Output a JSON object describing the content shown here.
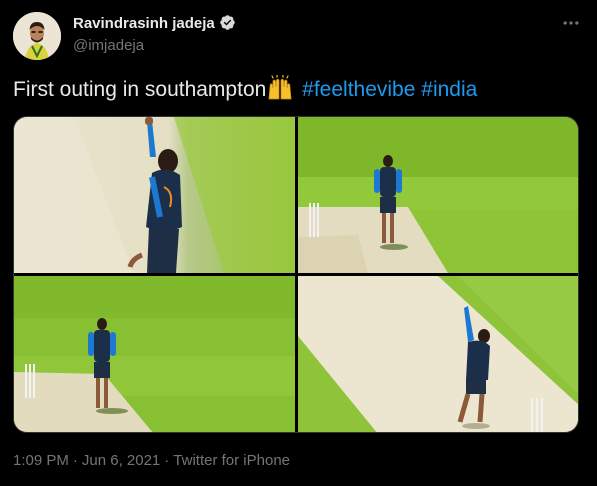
{
  "author": {
    "name": "Ravindrasinh jadeja",
    "handle": "@imjadeja",
    "verified": true
  },
  "tweet": {
    "text": "First outing in southampton",
    "emoji": "raising-hands",
    "hashtags": [
      "#feelthevibe",
      "#india"
    ]
  },
  "media": {
    "photos": [
      {
        "label": "photo-1"
      },
      {
        "label": "photo-2"
      },
      {
        "label": "photo-3"
      },
      {
        "label": "photo-4"
      }
    ]
  },
  "meta": {
    "time": "1:09 PM",
    "separator": "·",
    "date": "Jun 6, 2021",
    "source": "Twitter for iPhone"
  },
  "colors": {
    "background": "#000000",
    "text": "#e7e9ea",
    "secondary": "#71767b",
    "link": "#1d9bf0",
    "verified": "#d9d9d9"
  }
}
